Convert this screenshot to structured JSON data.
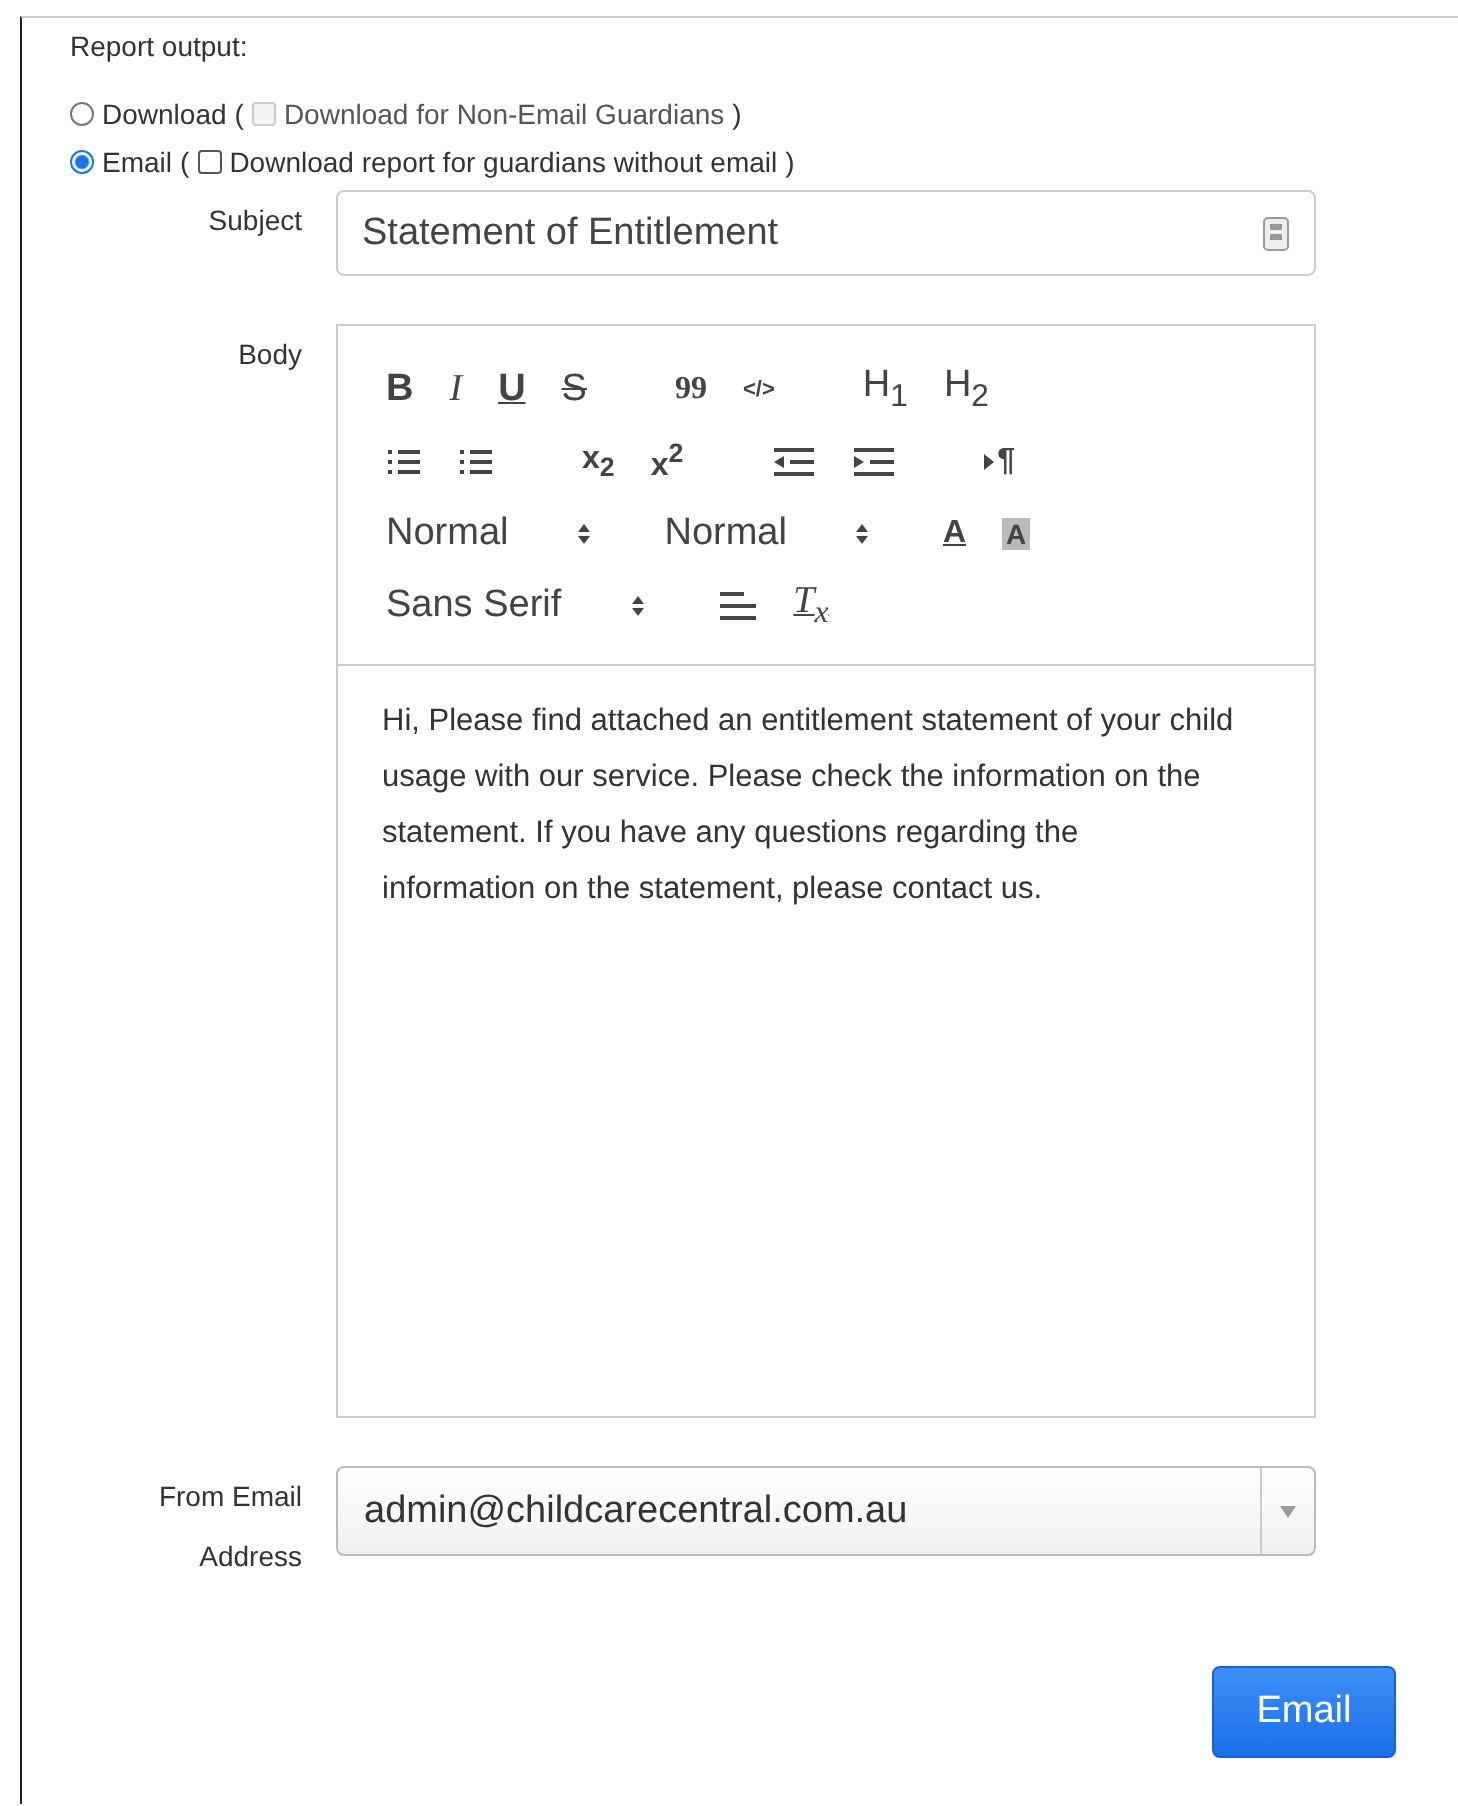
{
  "heading": "Report output:",
  "outputs": [
    {
      "label": "Download",
      "selected": false,
      "open": "(",
      "close": ")",
      "option": {
        "label": "Download for Non-Email Guardians",
        "checked": false,
        "disabled": true
      }
    },
    {
      "label": "Email",
      "selected": true,
      "open": "(",
      "close": ")",
      "option": {
        "label": "Download report for guardians without email",
        "checked": false,
        "disabled": false
      }
    }
  ],
  "subject": {
    "label": "Subject",
    "value": "Statement of Entitlement"
  },
  "body": {
    "label": "Body",
    "toolbar": [
      [
        {
          "kind": "bold",
          "label": "B"
        },
        {
          "kind": "italic",
          "label": "I"
        },
        {
          "kind": "underline",
          "label": "U"
        },
        {
          "kind": "strike",
          "label": "S"
        },
        {
          "kind": "gap"
        },
        {
          "kind": "quote",
          "label": "99"
        },
        {
          "kind": "code",
          "label": "</>"
        },
        {
          "kind": "gap"
        },
        {
          "kind": "header",
          "label": "H$_{1}$"
        },
        {
          "kind": "header",
          "label": "H$_{2}$"
        }
      ],
      [
        {
          "kind": "ordered-list"
        },
        {
          "kind": "bullet-list"
        },
        {
          "kind": "gap"
        },
        {
          "kind": "script",
          "label": "x$_{2}$"
        },
        {
          "kind": "script",
          "label": "x$^{2}$"
        },
        {
          "kind": "gap"
        },
        {
          "kind": "outdent"
        },
        {
          "kind": "indent"
        },
        {
          "kind": "gap"
        },
        {
          "kind": "direction",
          "label": "¶"
        }
      ],
      [
        {
          "kind": "picker",
          "label": "Normal"
        },
        {
          "kind": "picker",
          "label": "Normal"
        },
        {
          "kind": "color",
          "label": "A"
        },
        {
          "kind": "background",
          "label": "A"
        }
      ],
      [
        {
          "kind": "picker",
          "label": "Sans Serif"
        },
        {
          "kind": "align"
        },
        {
          "kind": "clean",
          "label": "T$_{x}$"
        }
      ]
    ],
    "text": "Hi, Please find attached an entitlement statement of your child usage with our service. Please check the information on the statement. If you have any questions regarding the information on the statement, please contact us."
  },
  "from": {
    "label": "From Email Address",
    "value": "admin@childcarecentral.com.au"
  },
  "submit": "Email"
}
